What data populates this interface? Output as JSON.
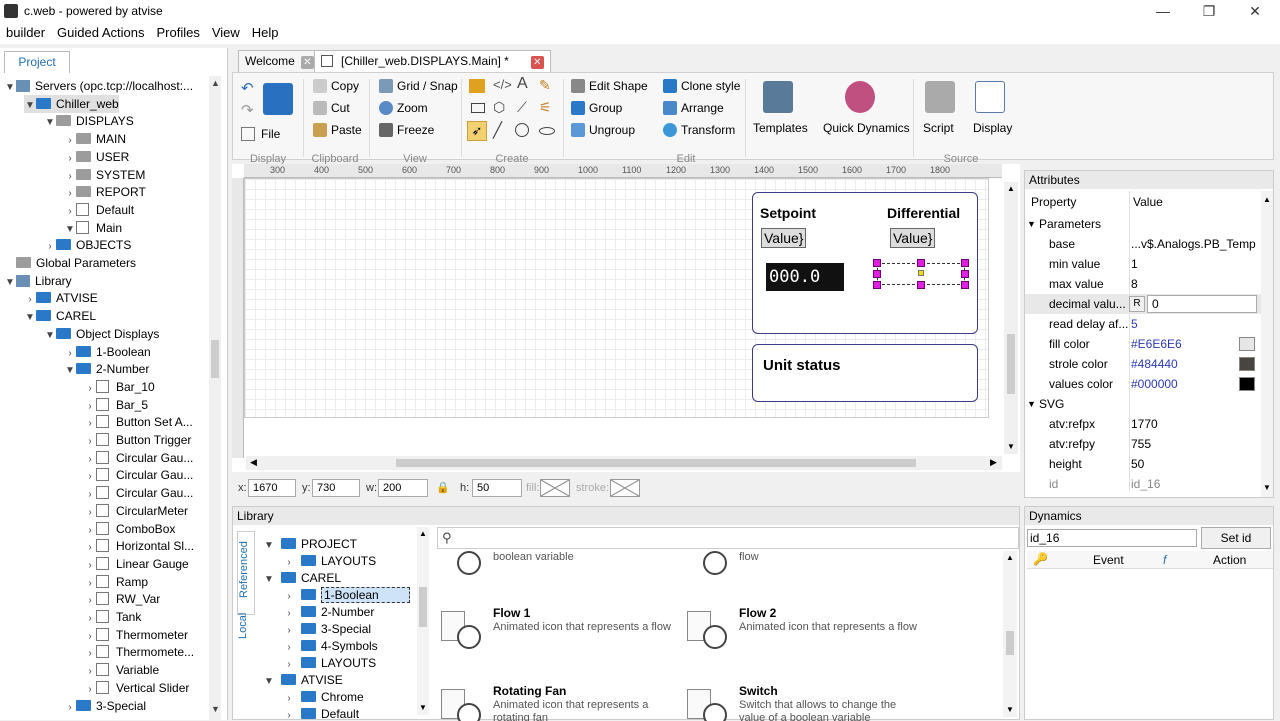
{
  "window": {
    "title": "c.web - powered by atvise"
  },
  "menu": [
    "builder",
    "Guided Actions",
    "Profiles",
    "View",
    "Help"
  ],
  "project_tab": "Project",
  "tree": [
    {
      "label": "Servers (opc.tcp://localhost:...",
      "indent": 0,
      "arrow": "▼",
      "icon": "srv"
    },
    {
      "label": "Chiller_web",
      "indent": 1,
      "arrow": "▼",
      "icon": "fold"
    },
    {
      "label": "DISPLAYS",
      "indent": 2,
      "arrow": "▼",
      "icon": "fold gray"
    },
    {
      "label": "MAIN",
      "indent": 3,
      "arrow": "›",
      "icon": "fold gray"
    },
    {
      "label": "USER",
      "indent": 3,
      "arrow": "›",
      "icon": "fold gray"
    },
    {
      "label": "SYSTEM",
      "indent": 3,
      "arrow": "›",
      "icon": "fold gray"
    },
    {
      "label": "REPORT",
      "indent": 3,
      "arrow": "›",
      "icon": "fold gray"
    },
    {
      "label": "Default",
      "indent": 3,
      "arrow": "›",
      "icon": "doc"
    },
    {
      "label": "Main",
      "indent": 3,
      "arrow": "▼",
      "icon": "doc"
    },
    {
      "label": "OBJECTS",
      "indent": 2,
      "arrow": "›",
      "icon": "fold"
    },
    {
      "label": "Global Parameters",
      "indent": 0,
      "arrow": "",
      "icon": "fold gray"
    },
    {
      "label": "Library",
      "indent": 0,
      "arrow": "▼",
      "icon": "srv"
    },
    {
      "label": "ATVISE",
      "indent": 1,
      "arrow": "›",
      "icon": "fold"
    },
    {
      "label": "CAREL",
      "indent": 1,
      "arrow": "▼",
      "icon": "fold"
    },
    {
      "label": "Object Displays",
      "indent": 2,
      "arrow": "▼",
      "icon": "fold"
    },
    {
      "label": "1-Boolean",
      "indent": 3,
      "arrow": "›",
      "icon": "fold"
    },
    {
      "label": "2-Number",
      "indent": 3,
      "arrow": "▼",
      "icon": "fold"
    },
    {
      "label": "Bar_10",
      "indent": 4,
      "arrow": "›",
      "icon": "doc"
    },
    {
      "label": "Bar_5",
      "indent": 4,
      "arrow": "›",
      "icon": "doc"
    },
    {
      "label": "Button Set A...",
      "indent": 4,
      "arrow": "›",
      "icon": "doc"
    },
    {
      "label": "Button Trigger",
      "indent": 4,
      "arrow": "›",
      "icon": "doc"
    },
    {
      "label": "Circular Gau...",
      "indent": 4,
      "arrow": "›",
      "icon": "doc"
    },
    {
      "label": "Circular Gau...",
      "indent": 4,
      "arrow": "›",
      "icon": "doc"
    },
    {
      "label": "Circular Gau...",
      "indent": 4,
      "arrow": "›",
      "icon": "doc"
    },
    {
      "label": "CircularMeter",
      "indent": 4,
      "arrow": "›",
      "icon": "doc"
    },
    {
      "label": "ComboBox",
      "indent": 4,
      "arrow": "›",
      "icon": "doc"
    },
    {
      "label": "Horizontal Sl...",
      "indent": 4,
      "arrow": "›",
      "icon": "doc"
    },
    {
      "label": "Linear Gauge",
      "indent": 4,
      "arrow": "›",
      "icon": "doc"
    },
    {
      "label": "Ramp",
      "indent": 4,
      "arrow": "›",
      "icon": "doc"
    },
    {
      "label": "RW_Var",
      "indent": 4,
      "arrow": "›",
      "icon": "doc"
    },
    {
      "label": "Tank",
      "indent": 4,
      "arrow": "›",
      "icon": "doc"
    },
    {
      "label": "Thermometer",
      "indent": 4,
      "arrow": "›",
      "icon": "doc"
    },
    {
      "label": "Thermomete...",
      "indent": 4,
      "arrow": "›",
      "icon": "doc"
    },
    {
      "label": "Variable",
      "indent": 4,
      "arrow": "›",
      "icon": "doc"
    },
    {
      "label": "Vertical Slider",
      "indent": 4,
      "arrow": "›",
      "icon": "doc"
    },
    {
      "label": "3-Special",
      "indent": 3,
      "arrow": "›",
      "icon": "fold"
    }
  ],
  "tabs": {
    "welcome": "Welcome",
    "main": "[Chiller_web.DISPLAYS.Main] *"
  },
  "ribbon": {
    "display": {
      "file": "File",
      "group": "Display"
    },
    "clipboard": {
      "copy": "Copy",
      "cut": "Cut",
      "paste": "Paste",
      "group": "Clipboard"
    },
    "view": {
      "grid": "Grid / Snap",
      "zoom": "Zoom",
      "freeze": "Freeze",
      "group": "View"
    },
    "create": {
      "group": "Create"
    },
    "edit": {
      "edit_shape": "Edit Shape",
      "group_btn": "Group",
      "ungroup": "Ungroup",
      "clone": "Clone style",
      "arrange": "Arrange",
      "transform": "Transform",
      "group": "Edit"
    },
    "templates": "Templates",
    "quick_dynamics": "Quick Dynamics",
    "script": "Script",
    "display_btn": "Display",
    "source_group": "Source"
  },
  "ruler_ticks": [
    "300",
    "400",
    "500",
    "600",
    "700",
    "800",
    "900",
    "1000",
    "1100",
    "1200",
    "1300",
    "1400",
    "1500",
    "1600",
    "1700",
    "1800"
  ],
  "canvas": {
    "setpoint": "Setpoint",
    "differential": "Differential",
    "value1": "Value}",
    "value2": "Value}",
    "digital": "000.0",
    "unit_status": "Unit status"
  },
  "coords": {
    "x_label": "x:",
    "x": "1670",
    "y_label": "y:",
    "y": "730",
    "w_label": "w:",
    "w": "200",
    "h_label": "h:",
    "h": "50",
    "fill": "fill:",
    "stroke": "stroke:"
  },
  "attributes": {
    "title": "Attributes",
    "col_property": "Property",
    "col_value": "Value",
    "parameters": "Parameters",
    "rows": [
      {
        "p": "base",
        "v": "...v$.Analogs.PB_Temp"
      },
      {
        "p": "min value",
        "v": "1"
      },
      {
        "p": "max value",
        "v": "8"
      },
      {
        "p": "decimal valu...",
        "v": "0"
      },
      {
        "p": "read delay af...",
        "v": "5"
      },
      {
        "p": "fill color",
        "v": "#E6E6E6",
        "sw": "#e6e6e6"
      },
      {
        "p": "strole color",
        "v": "#484440",
        "sw": "#484440"
      },
      {
        "p": "values color",
        "v": "#000000",
        "sw": "#000000"
      }
    ],
    "r_badge": "R",
    "svg": "SVG",
    "svg_rows": [
      {
        "p": "atv:refpx",
        "v": "1770"
      },
      {
        "p": "atv:refpy",
        "v": "755"
      },
      {
        "p": "height",
        "v": "50"
      },
      {
        "p": "id",
        "v": "id_16"
      }
    ]
  },
  "library": {
    "title": "Library",
    "side_tabs": [
      "Referenced",
      "Local"
    ],
    "tree": [
      {
        "label": "PROJECT",
        "indent": 0,
        "arrow": "▼"
      },
      {
        "label": "LAYOUTS",
        "indent": 1,
        "arrow": "›"
      },
      {
        "label": "CAREL",
        "indent": 0,
        "arrow": "▼"
      },
      {
        "label": "1-Boolean",
        "indent": 1,
        "arrow": "›"
      },
      {
        "label": "2-Number",
        "indent": 1,
        "arrow": "›"
      },
      {
        "label": "3-Special",
        "indent": 1,
        "arrow": "›"
      },
      {
        "label": "4-Symbols",
        "indent": 1,
        "arrow": "›"
      },
      {
        "label": "LAYOUTS",
        "indent": 1,
        "arrow": "›"
      },
      {
        "label": "ATVISE",
        "indent": 0,
        "arrow": "▼"
      },
      {
        "label": "Chrome",
        "indent": 1,
        "arrow": "›"
      },
      {
        "label": "Default",
        "indent": 1,
        "arrow": "›"
      }
    ],
    "items": [
      {
        "name": "",
        "desc": "boolean variable"
      },
      {
        "name": "",
        "desc": "flow"
      },
      {
        "name": "Flow 1",
        "desc": "Animated icon that represents a flow"
      },
      {
        "name": "Flow 2",
        "desc": "Animated icon that represents a flow"
      },
      {
        "name": "Rotating Fan",
        "desc": "Animated icon that represents a rotating fan"
      },
      {
        "name": "Switch",
        "desc": "Switch that allows to change the value of a boolean variable"
      }
    ]
  },
  "dynamics": {
    "title": "Dynamics",
    "id": "id_16",
    "set_id": "Set id",
    "col_event": "Event",
    "col_f": "f",
    "col_action": "Action"
  }
}
